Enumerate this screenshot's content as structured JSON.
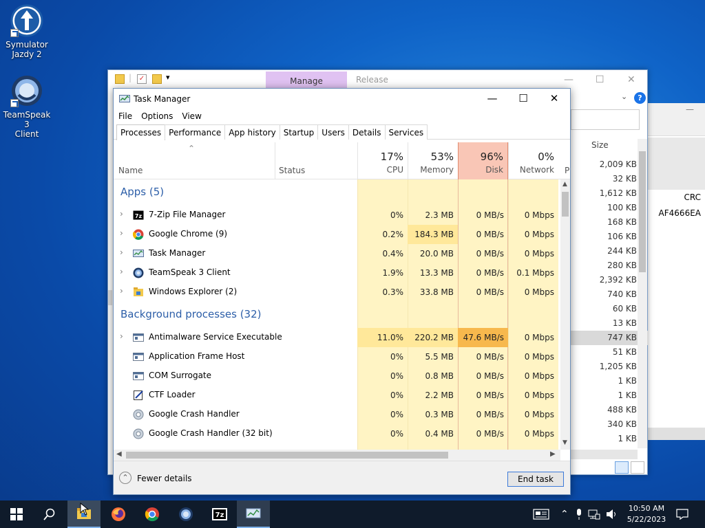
{
  "desktop": {
    "icons": [
      {
        "label_line1": "Symulator",
        "label_line2": "Jazdy 2"
      },
      {
        "label_line1": "TeamSpeak 3",
        "label_line2": "Client"
      }
    ]
  },
  "explorer": {
    "manage_tab": "Manage",
    "release_tab": "Release",
    "size_header": "Size",
    "sizes": [
      "2,009 KB",
      "32 KB",
      "1,612 KB",
      "100 KB",
      "168 KB",
      "106 KB",
      "244 KB",
      "280 KB",
      "2,392 KB",
      "740 KB",
      "60 KB",
      "13 KB",
      "747 KB",
      "51 KB",
      "1,205 KB",
      "1 KB",
      "1 KB",
      "488 KB",
      "340 KB",
      "1 KB"
    ]
  },
  "side_window": {
    "crc_header": "CRC",
    "crc_value": "AF4666EA"
  },
  "task_manager": {
    "title": "Task Manager",
    "menu": [
      "File",
      "Options",
      "View"
    ],
    "tabs": [
      "Processes",
      "Performance",
      "App history",
      "Startup",
      "Users",
      "Details",
      "Services"
    ],
    "columns": {
      "name": "Name",
      "status": "Status",
      "cpu": {
        "pct": "17%",
        "label": "CPU"
      },
      "memory": {
        "pct": "53%",
        "label": "Memory"
      },
      "disk": {
        "pct": "96%",
        "label": "Disk"
      },
      "network": {
        "pct": "0%",
        "label": "Network"
      },
      "power": "P"
    },
    "apps_header": "Apps (5)",
    "bg_header": "Background processes (32)",
    "apps": [
      {
        "name": "7-Zip File Manager",
        "cpu": "0%",
        "mem": "2.3 MB",
        "disk": "0 MB/s",
        "net": "0 Mbps"
      },
      {
        "name": "Google Chrome (9)",
        "cpu": "0.2%",
        "mem": "184.3 MB",
        "disk": "0 MB/s",
        "net": "0 Mbps"
      },
      {
        "name": "Task Manager",
        "cpu": "0.4%",
        "mem": "20.0 MB",
        "disk": "0 MB/s",
        "net": "0 Mbps"
      },
      {
        "name": "TeamSpeak 3 Client",
        "cpu": "1.9%",
        "mem": "13.3 MB",
        "disk": "0 MB/s",
        "net": "0.1 Mbps"
      },
      {
        "name": "Windows Explorer (2)",
        "cpu": "0.3%",
        "mem": "33.8 MB",
        "disk": "0 MB/s",
        "net": "0 Mbps"
      }
    ],
    "background": [
      {
        "name": "Antimalware Service Executable",
        "cpu": "11.0%",
        "mem": "220.2 MB",
        "disk": "47.6 MB/s",
        "net": "0 Mbps"
      },
      {
        "name": "Application Frame Host",
        "cpu": "0%",
        "mem": "5.5 MB",
        "disk": "0 MB/s",
        "net": "0 Mbps"
      },
      {
        "name": "COM Surrogate",
        "cpu": "0%",
        "mem": "0.8 MB",
        "disk": "0 MB/s",
        "net": "0 Mbps"
      },
      {
        "name": "CTF Loader",
        "cpu": "0%",
        "mem": "2.2 MB",
        "disk": "0 MB/s",
        "net": "0 Mbps"
      },
      {
        "name": "Google Crash Handler",
        "cpu": "0%",
        "mem": "0.3 MB",
        "disk": "0 MB/s",
        "net": "0 Mbps"
      },
      {
        "name": "Google Crash Handler (32 bit)",
        "cpu": "0%",
        "mem": "0.4 MB",
        "disk": "0 MB/s",
        "net": "0 Mbps"
      }
    ],
    "fewer_details": "Fewer details",
    "end_task": "End task"
  },
  "taskbar": {
    "time": "10:50 AM",
    "date": "5/22/2023"
  },
  "colors": {
    "heat_light": "#fff4c4",
    "heat_mid": "#ffe89a",
    "heat_strong": "#f7b84d",
    "disk_header": "#f9c6b6",
    "accent": "#2c5ea8"
  }
}
